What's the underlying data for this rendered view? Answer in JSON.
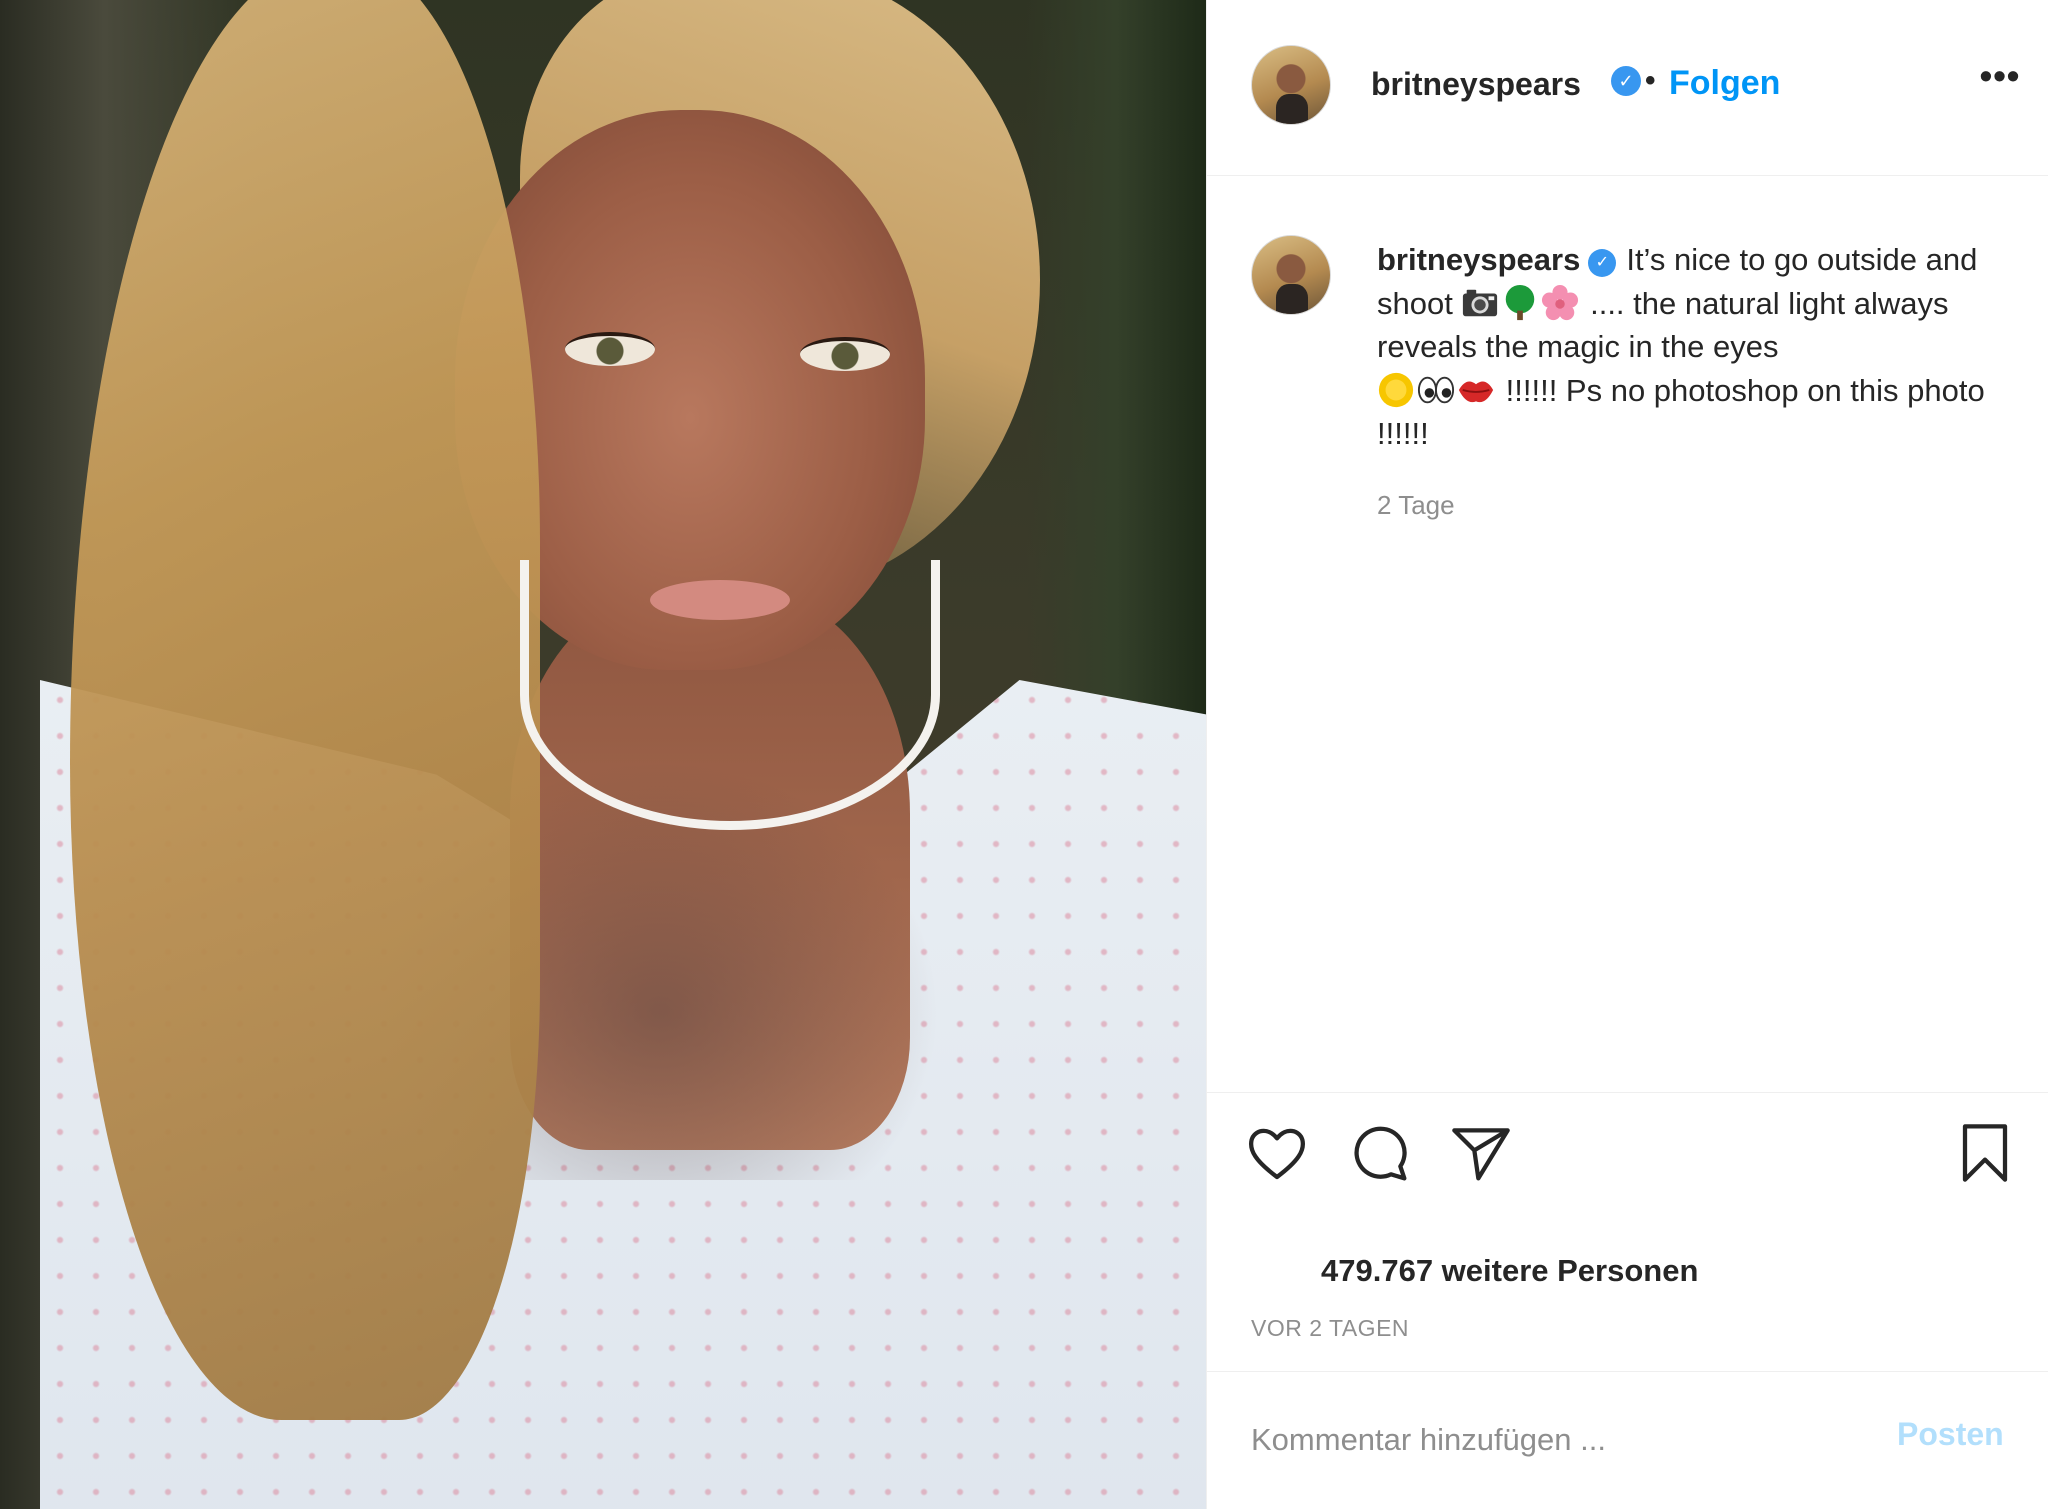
{
  "post": {
    "author": {
      "username": "britneyspears",
      "verified_icon": "verified-badge-icon",
      "follow_label": "Folgen",
      "separator": "•",
      "more_label": "•••"
    },
    "caption": {
      "username": "britneyspears",
      "part1": "It’s nice to go outside and shoot",
      "emojis1": [
        "camera-icon",
        "tree-icon",
        "blossom-icon"
      ],
      "part2": ".... the natural light always reveals the magic in the eyes",
      "emojis2": [
        "sun-icon",
        "eyes-icon",
        "lips-icon"
      ],
      "part3": "!!!!!!  Ps no photoshop on this photo !!!!!!",
      "age": "2 Tage"
    },
    "actions": {
      "like_icon": "heart-icon",
      "comment_icon": "comment-icon",
      "share_icon": "share-icon",
      "save_icon": "bookmark-icon"
    },
    "likes_text": "479.767 weitere Personen",
    "timestamp": "VOR 2 TAGEN",
    "comment": {
      "placeholder": "Kommentar hinzufügen ...",
      "post_label": "Posten"
    }
  },
  "colors": {
    "accent": "#0095f6",
    "verified": "#3897f0",
    "muted": "#8e8e8e",
    "post_disabled": "#b2dffc",
    "text": "#262626"
  }
}
